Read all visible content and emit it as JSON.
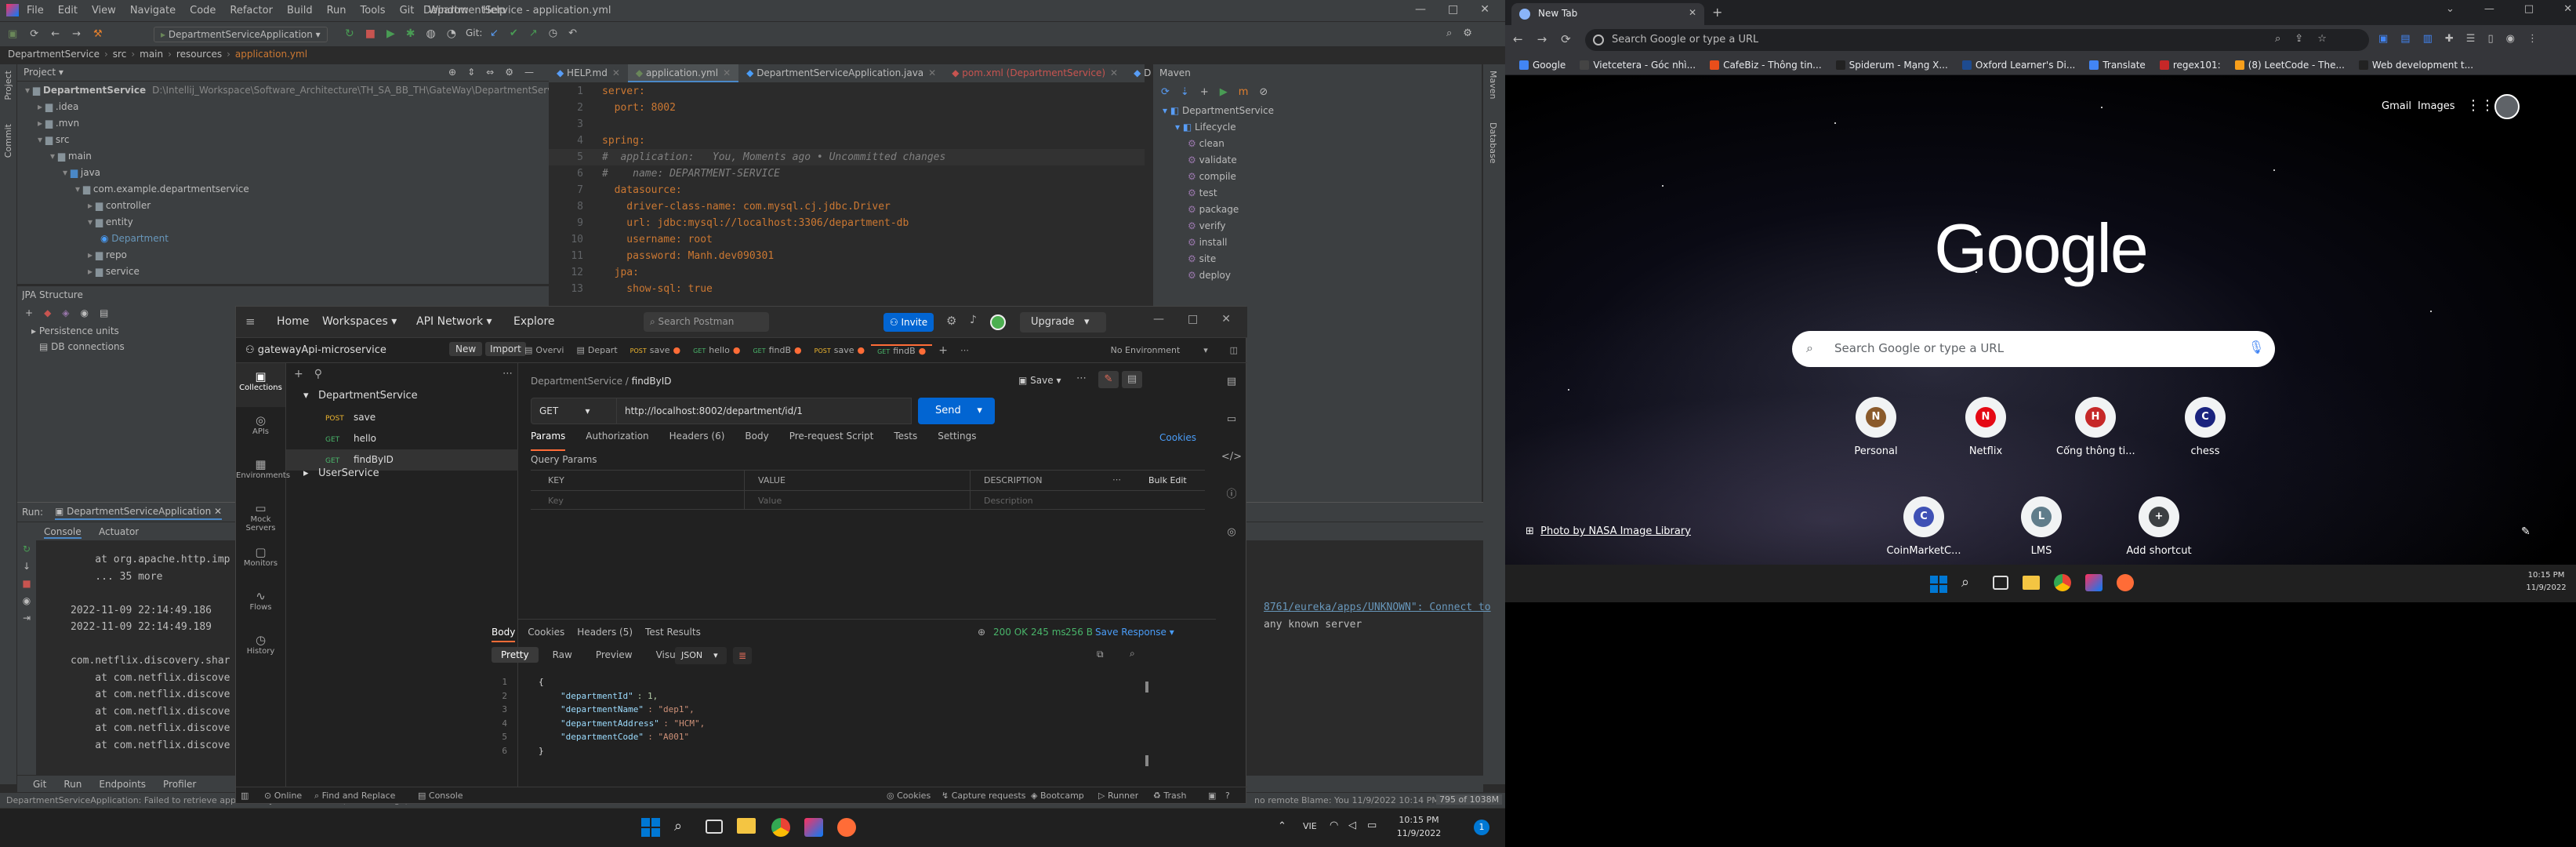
{
  "intellij": {
    "menu": [
      "File",
      "Edit",
      "View",
      "Navigate",
      "Code",
      "Refactor",
      "Build",
      "Run",
      "Tools",
      "Git",
      "Window",
      "Help"
    ],
    "window_title": "DepartmentService - application.yml",
    "run_config": "DepartmentServiceApplication",
    "git_label": "Git:",
    "breadcrumb": [
      "DepartmentService",
      "src",
      "main",
      "resources",
      "application.yml"
    ],
    "project_label": "Project",
    "tree": [
      {
        "label": "DepartmentService",
        "extra": "D:\\Intellij_Workspace\\Software_Architecture\\TH_SA_BB_TH\\GateWay\\DepartmentService"
      },
      {
        "label": ".idea"
      },
      {
        "label": ".mvn"
      },
      {
        "label": "src"
      },
      {
        "label": "main"
      },
      {
        "label": "java"
      },
      {
        "label": "com.example.departmentservice"
      },
      {
        "label": "controller"
      },
      {
        "label": "entity"
      },
      {
        "label": "Department"
      },
      {
        "label": "repo"
      },
      {
        "label": "service"
      }
    ],
    "jpa_structure_label": "JPA Structure",
    "jpa_items": [
      "Persistence units",
      "DB connections"
    ],
    "tabs": [
      "HELP.md",
      "application.yml",
      "DepartmentServiceApplication.java",
      "pom.xml (DepartmentService)",
      "D"
    ],
    "code_lines": [
      {
        "n": "1",
        "text": "server:"
      },
      {
        "n": "2",
        "text": "  port: 8002"
      },
      {
        "n": "3",
        "text": ""
      },
      {
        "n": "4",
        "text": "spring:"
      },
      {
        "n": "5",
        "text": "#  application:   You, Moments ago • Uncommitted changes"
      },
      {
        "n": "6",
        "text": "#    name: DEPARTMENT-SERVICE"
      },
      {
        "n": "7",
        "text": "  datasource:"
      },
      {
        "n": "8",
        "text": "    driver-class-name: com.mysql.cj.jdbc.Driver"
      },
      {
        "n": "9",
        "text": "    url: jdbc:mysql://localhost:3306/department-db"
      },
      {
        "n": "10",
        "text": "    username: root"
      },
      {
        "n": "11",
        "text": "    password: Manh.dev090301"
      },
      {
        "n": "12",
        "text": "  jpa:"
      },
      {
        "n": "13",
        "text": "    show-sql: true"
      }
    ],
    "maven_label": "Maven",
    "maven_tree": [
      "DepartmentService",
      "Lifecycle",
      "clean",
      "validate",
      "compile",
      "test",
      "package",
      "verify",
      "install",
      "site",
      "deploy"
    ],
    "run_label": "Run:",
    "run_tab": "DepartmentServiceApplication",
    "console_tabs": [
      "Console",
      "Actuator"
    ],
    "console_lines": [
      "    at org.apache.http.imp",
      "    ... 35 more",
      "",
      "2022-11-09 22:14:49.186",
      "2022-11-09 22:14:49.189",
      "",
      "com.netflix.discovery.shar",
      "    at com.netflix.discove",
      "    at com.netflix.discove",
      "    at com.netflix.discove",
      "    at com.netflix.discove",
      "    at com.netflix.discove"
    ],
    "console_right_1": "8761/eureka/apps/UNKNOWN\": Connect to",
    "console_right_2": "any known server",
    "bottom_tabs": [
      "Git",
      "Run",
      "Endpoints",
      "Profiler"
    ],
    "status_left": "DepartmentServiceApplication: Failed to retrieve application JMX service URL (moments ago)",
    "status_right": "Blame: You 11/9/2022 10:14 PM",
    "status_right2": "795 of 1038M",
    "status_mid": "no remote"
  },
  "postman": {
    "nav": [
      "Home",
      "Workspaces",
      "API Network",
      "Explore"
    ],
    "search_placeholder": "Search Postman",
    "invite": "Invite",
    "upgrade": "Upgrade",
    "workspace": "gatewayApi-microservice",
    "new_btn": "New",
    "import_btn": "Import",
    "sidebar": [
      "Collections",
      "APIs",
      "Environments",
      "Mock Servers",
      "Monitors",
      "Flows",
      "History"
    ],
    "collection": "DepartmentService",
    "requests": [
      {
        "method": "POST",
        "name": "save"
      },
      {
        "method": "GET",
        "name": "hello"
      },
      {
        "method": "GET",
        "name": "findByID"
      }
    ],
    "collection2": "UserService",
    "req_tabs": [
      {
        "method": "",
        "name": "Overvi"
      },
      {
        "method": "",
        "name": "Depart"
      },
      {
        "method": "POST",
        "name": "save"
      },
      {
        "method": "GET",
        "name": "hello"
      },
      {
        "method": "GET",
        "name": "findB"
      },
      {
        "method": "POST",
        "name": "save"
      },
      {
        "method": "GET",
        "name": "findB"
      }
    ],
    "environment": "No Environment",
    "crumb_parent": "DepartmentService",
    "crumb_current": "findByID",
    "save_btn": "Save",
    "method": "GET",
    "url": "http://localhost:8002/department/id/1",
    "send": "Send",
    "req_subtabs": [
      "Params",
      "Authorization",
      "Headers (6)",
      "Body",
      "Pre-request Script",
      "Tests",
      "Settings"
    ],
    "cookies": "Cookies",
    "query_params": "Query Params",
    "table_headers": [
      "KEY",
      "VALUE",
      "DESCRIPTION"
    ],
    "bulk_edit": "Bulk Edit",
    "placeholders": [
      "Key",
      "Value",
      "Description"
    ],
    "resp_tabs": [
      "Body",
      "Cookies",
      "Headers (5)",
      "Test Results"
    ],
    "status": "200 OK",
    "time": "245 ms",
    "size": "256 B",
    "save_response": "Save Response",
    "view_tabs": [
      "Pretty",
      "Raw",
      "Preview",
      "Visualize"
    ],
    "format": "JSON",
    "response_lines": [
      {
        "n": "1",
        "text": "{"
      },
      {
        "n": "2",
        "key": "\"departmentId\"",
        "val": "1,"
      },
      {
        "n": "3",
        "key": "\"departmentName\"",
        "val": "\"dep1\","
      },
      {
        "n": "4",
        "key": "\"departmentAddress\"",
        "val": "\"HCM\","
      },
      {
        "n": "5",
        "key": "\"departmentCode\"",
        "val": "\"A001\""
      },
      {
        "n": "6",
        "text": "}"
      }
    ],
    "footer": [
      "Online",
      "Find and Replace",
      "Console",
      "Cookies",
      "Capture requests",
      "Bootcamp",
      "Runner",
      "Trash"
    ]
  },
  "chrome": {
    "tab_title": "New Tab",
    "omnibox_placeholder": "Search Google or type a URL",
    "bookmarks": [
      "Google",
      "Vietcetera - Góc nhì...",
      "CafeBiz - Thông tin...",
      "Spiderum - Mạng X...",
      "Oxford Learner's Di...",
      "Translate",
      "regex101:",
      "(8) LeetCode - The...",
      "Web development t..."
    ],
    "gmail": "Gmail",
    "images": "Images",
    "logo": "Google",
    "search_placeholder": "Search Google or type a URL",
    "shortcuts_row1": [
      {
        "label": "Personal",
        "letter": "N",
        "color": "#8a5a2b"
      },
      {
        "label": "Netflix",
        "letter": "N",
        "color": "#e50914"
      },
      {
        "label": "Cổng thông ti...",
        "letter": "H",
        "color": "#c62828"
      },
      {
        "label": "chess",
        "letter": "C",
        "color": "#1a237e"
      }
    ],
    "shortcuts_row2": [
      {
        "label": "CoinMarketC...",
        "letter": "C",
        "color": "#3f51b5"
      },
      {
        "label": "LMS",
        "letter": "L",
        "color": "#607d8b"
      },
      {
        "label": "Add shortcut",
        "letter": "+",
        "color": "#3c4043"
      }
    ],
    "photo_credit": "Photo by NASA Image Library",
    "clock_time": "10:15 PM",
    "clock_date": "11/9/2022"
  },
  "taskbar": {
    "lang": "VIE",
    "time": "10:15 PM",
    "date": "11/9/2022",
    "notif": "1"
  }
}
